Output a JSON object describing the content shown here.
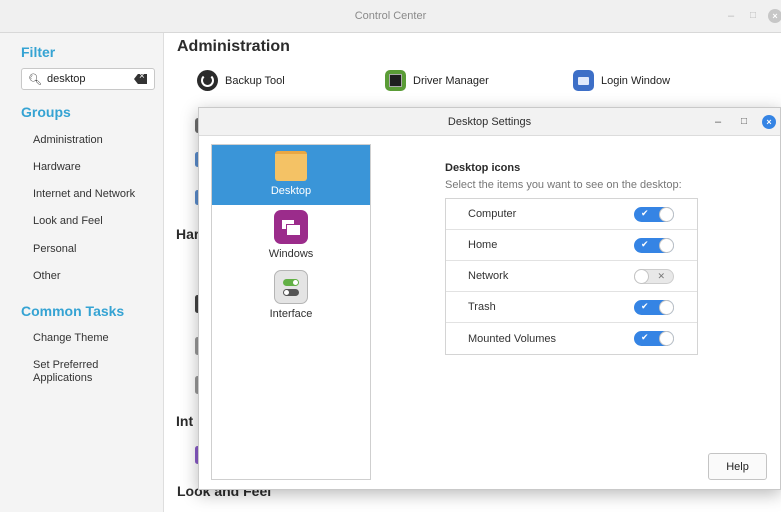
{
  "control_center": {
    "title": "Control Center",
    "sidebar": {
      "filter_heading": "Filter",
      "search_value": "desktop",
      "groups_heading": "Groups",
      "groups": [
        "Administration",
        "Hardware",
        "Internet and Network",
        "Look and Feel",
        "Personal",
        "Other"
      ],
      "tasks_heading": "Common Tasks",
      "tasks": [
        "Change Theme",
        "Set Preferred\nApplications"
      ]
    },
    "main": {
      "administration_title": "Administration",
      "apps": [
        "Backup Tool",
        "Driver Manager",
        "Login Window"
      ],
      "hardware_title_partial": "Har",
      "internet_title_partial": "Int",
      "look_title": "Look and Feel"
    }
  },
  "dialog": {
    "title": "Desktop Settings",
    "nav": [
      {
        "label": "Desktop",
        "icon": "desktop-icon",
        "active": true
      },
      {
        "label": "Windows",
        "icon": "windows-icon",
        "active": false
      },
      {
        "label": "Interface",
        "icon": "interface-icon",
        "active": false
      }
    ],
    "section_title": "Desktop icons",
    "section_subtitle": "Select the items you want to see on the desktop:",
    "options": [
      {
        "label": "Computer",
        "enabled": true
      },
      {
        "label": "Home",
        "enabled": true
      },
      {
        "label": "Network",
        "enabled": false
      },
      {
        "label": "Trash",
        "enabled": true
      },
      {
        "label": "Mounted Volumes",
        "enabled": true
      }
    ],
    "help_label": "Help"
  },
  "colors": {
    "accent": "#3584e4",
    "heading_blue": "#35a3d3",
    "nav_active": "#3a95d8"
  }
}
